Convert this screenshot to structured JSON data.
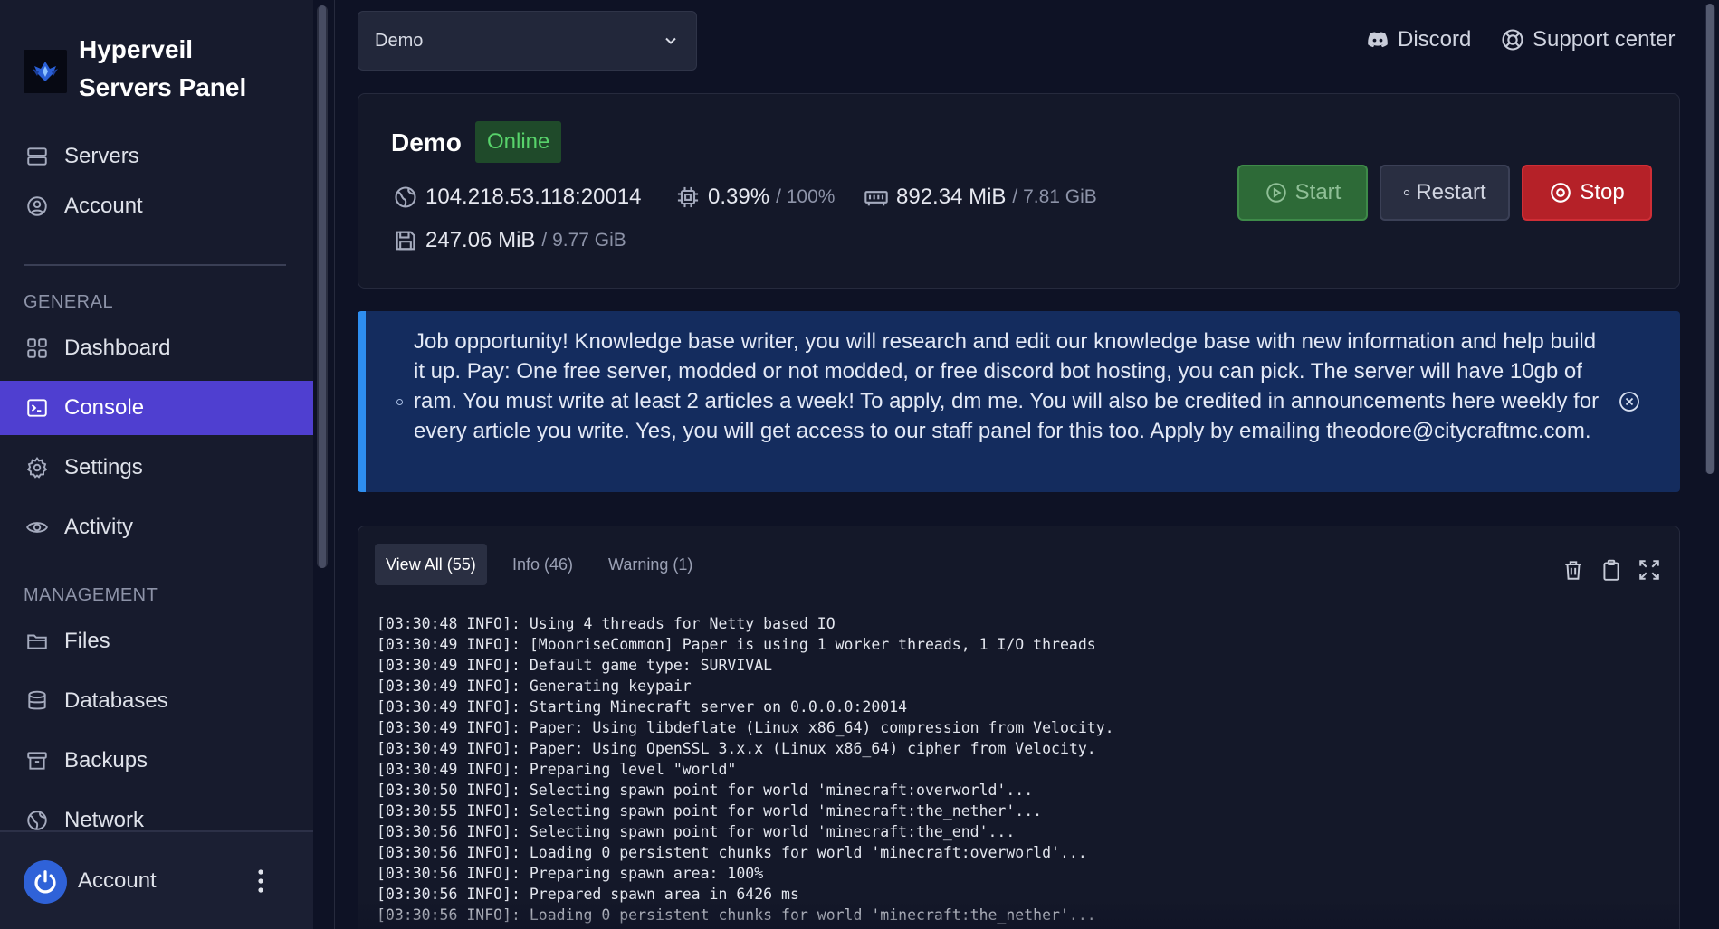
{
  "brand": {
    "line1": "Hyperveil",
    "line2": "Servers Panel"
  },
  "sidebar": {
    "top_items": [
      {
        "label": "Servers",
        "icon": "server-icon"
      },
      {
        "label": "Account",
        "icon": "user-circle-icon"
      }
    ],
    "general_label": "GENERAL",
    "general_items": [
      {
        "label": "Dashboard",
        "icon": "grid-icon"
      },
      {
        "label": "Console",
        "icon": "terminal-icon",
        "active": true
      },
      {
        "label": "Settings",
        "icon": "gear-icon"
      },
      {
        "label": "Activity",
        "icon": "eye-icon"
      }
    ],
    "management_label": "MANAGEMENT",
    "management_items": [
      {
        "label": "Files",
        "icon": "folder-icon"
      },
      {
        "label": "Databases",
        "icon": "database-icon"
      },
      {
        "label": "Backups",
        "icon": "archive-icon"
      },
      {
        "label": "Network",
        "icon": "globe-icon"
      }
    ],
    "user": {
      "name": "Account"
    }
  },
  "topbar": {
    "server_select": "Demo",
    "discord": "Discord",
    "support": "Support center"
  },
  "server": {
    "name": "Demo",
    "status": "Online",
    "address": "104.218.53.118:20014",
    "cpu": "0.39%",
    "cpu_limit": "/ 100%",
    "memory": "892.34 MiB",
    "memory_limit": "/ 7.81 GiB",
    "disk": "247.06 MiB",
    "disk_limit": "/ 9.77 GiB",
    "buttons": {
      "start": "Start",
      "restart": "Restart",
      "stop": "Stop"
    }
  },
  "alert": {
    "text": "Job opportunity! Knowledge base writer, you will research and edit our knowledge base with new information and help build it up. Pay: One free server, modded or not modded, or free discord bot hosting, you can pick. The server will have 10gb of ram. You must write at least 2 articles a week! To apply, dm me. You will also be credited in announcements here weekly for every article you write. Yes, you will get access to our staff panel for this too. Apply by emailing theodore@citycraftmc.com."
  },
  "console": {
    "tabs": [
      "View All (55)",
      "Info (46)",
      "Warning (1)"
    ],
    "lines": [
      "[03:30:48 INFO]: Using 4 threads for Netty based IO",
      "[03:30:49 INFO]: [MoonriseCommon] Paper is using 1 worker threads, 1 I/O threads",
      "[03:30:49 INFO]: Default game type: SURVIVAL",
      "[03:30:49 INFO]: Generating keypair",
      "[03:30:49 INFO]: Starting Minecraft server on 0.0.0.0:20014",
      "[03:30:49 INFO]: Paper: Using libdeflate (Linux x86_64) compression from Velocity.",
      "[03:30:49 INFO]: Paper: Using OpenSSL 3.x.x (Linux x86_64) cipher from Velocity.",
      "[03:30:49 INFO]: Preparing level \"world\"",
      "[03:30:50 INFO]: Selecting spawn point for world 'minecraft:overworld'...",
      "[03:30:55 INFO]: Selecting spawn point for world 'minecraft:the_nether'...",
      "[03:30:56 INFO]: Selecting spawn point for world 'minecraft:the_end'...",
      "[03:30:56 INFO]: Loading 0 persistent chunks for world 'minecraft:overworld'...",
      "[03:30:56 INFO]: Preparing spawn area: 100%",
      "[03:30:56 INFO]: Prepared spawn area in 6426 ms",
      "[03:30:56 INFO]: Loading 0 persistent chunks for world 'minecraft:the_nether'..."
    ]
  },
  "colors": {
    "accent": "#4f3fd0",
    "online": "#58d36b",
    "start": "#2d6a37",
    "stop": "#b52128",
    "alert_border": "#2e8ef0"
  }
}
